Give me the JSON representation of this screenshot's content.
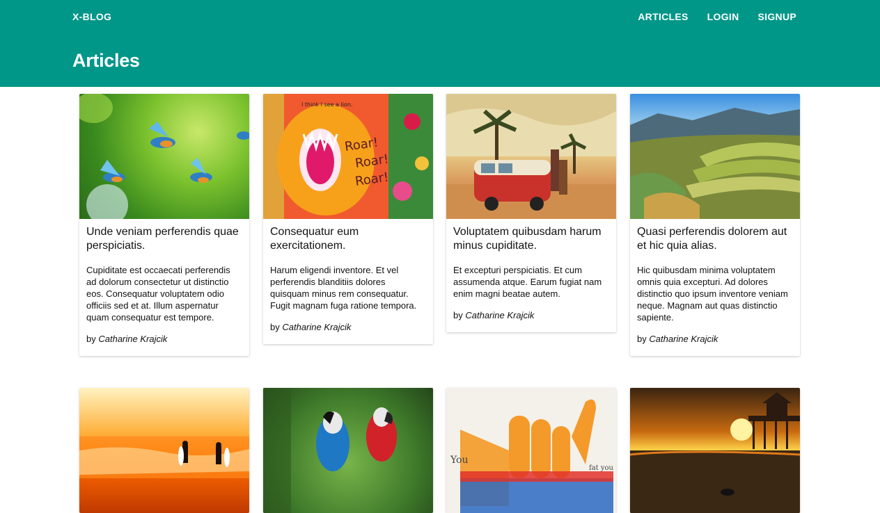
{
  "brand": "X-BLOG",
  "nav": {
    "articles": "ARTICLES",
    "login": "LOGIN",
    "signup": "SIGNUP"
  },
  "page_title": "Articles",
  "colors": {
    "header": "#009688",
    "header_text": "#ffffff"
  },
  "articles": [
    {
      "title": "Unde veniam perferendis quae perspiciatis.",
      "excerpt": "Cupiditate est occaecati perferendis ad dolorum consectetur ut distinctio eos. Consequatur voluptatem odio officiis sed et at. Illum aspernatur quam consequatur est tempore.",
      "by": "by",
      "author": "Catharine Krajcik",
      "image": "kingfisher-birds"
    },
    {
      "title": "Consequatur eum exercitationem.",
      "excerpt": "Harum eligendi inventore. Et vel perferendis blanditiis dolores quisquam minus rem consequatur. Fugit magnam fuga ratione tempora.",
      "by": "by",
      "author": "Catharine Krajcik",
      "image": "lion-illustration",
      "image_text": {
        "caption": "I think I see a lion.",
        "roar1": "Roar!",
        "roar2": "Roar!",
        "roar3": "Roar!"
      }
    },
    {
      "title": "Voluptatem quibusdam harum minus cupiditate.",
      "excerpt": "Et excepturi perspiciatis. Et cum assumenda atque. Earum fugiat nam enim magni beatae autem.",
      "by": "by",
      "author": "Catharine Krajcik",
      "image": "beach-van"
    },
    {
      "title": "Quasi perferendis dolorem aut et hic quia alias.",
      "excerpt": "Hic quibusdam minima voluptatem omnis quia excepturi. Ad dolores distinctio quo ipsum inventore veniam neque. Magnam aut quas distinctio sapiente.",
      "by": "by",
      "author": "Catharine Krajcik",
      "image": "rice-terraces"
    },
    {
      "image": "surfers-sunset"
    },
    {
      "image": "macaw-parrots"
    },
    {
      "image": "shaka-hand-illustration",
      "image_text": {
        "left": "You",
        "right": "fat you"
      }
    },
    {
      "image": "pier-sunset"
    }
  ]
}
